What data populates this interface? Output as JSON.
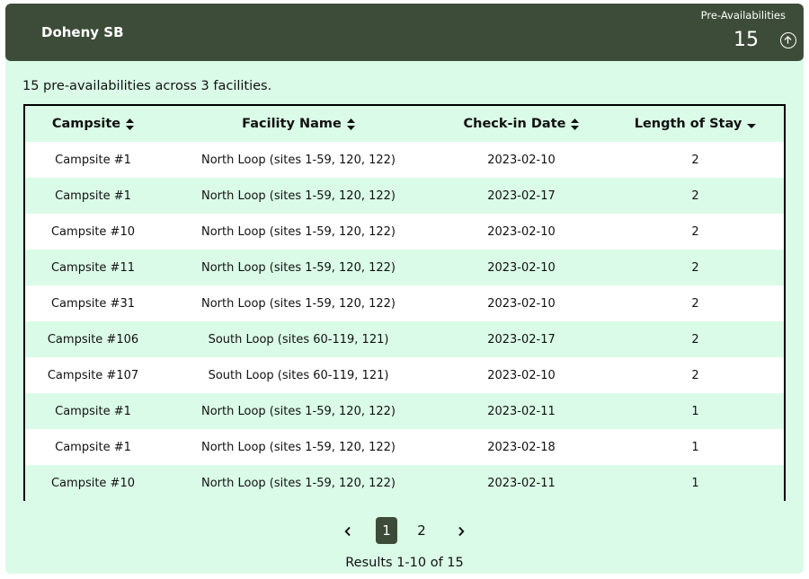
{
  "header": {
    "park_name": "Doheny SB",
    "stat_label": "Pre-Availabilities",
    "stat_value": "15"
  },
  "summary": "15 pre-availabilities across 3 facilities.",
  "table": {
    "columns": [
      "Campsite",
      "Facility Name",
      "Check-in Date",
      "Length of Stay"
    ],
    "rows": [
      [
        "Campsite #1",
        "North Loop (sites 1-59, 120, 122)",
        "2023-02-10",
        "2"
      ],
      [
        "Campsite #1",
        "North Loop (sites 1-59, 120, 122)",
        "2023-02-17",
        "2"
      ],
      [
        "Campsite #10",
        "North Loop (sites 1-59, 120, 122)",
        "2023-02-10",
        "2"
      ],
      [
        "Campsite #11",
        "North Loop (sites 1-59, 120, 122)",
        "2023-02-10",
        "2"
      ],
      [
        "Campsite #31",
        "North Loop (sites 1-59, 120, 122)",
        "2023-02-10",
        "2"
      ],
      [
        "Campsite #106",
        "South Loop (sites 60-119, 121)",
        "2023-02-17",
        "2"
      ],
      [
        "Campsite #107",
        "South Loop (sites 60-119, 121)",
        "2023-02-10",
        "2"
      ],
      [
        "Campsite #1",
        "North Loop (sites 1-59, 120, 122)",
        "2023-02-11",
        "1"
      ],
      [
        "Campsite #1",
        "North Loop (sites 1-59, 120, 122)",
        "2023-02-18",
        "1"
      ],
      [
        "Campsite #10",
        "North Loop (sites 1-59, 120, 122)",
        "2023-02-11",
        "1"
      ]
    ]
  },
  "pagination": {
    "pages": [
      "1",
      "2"
    ],
    "current": "1"
  },
  "results_text": "Results 1-10 of 15",
  "colors": {
    "header_bg": "#3d4c38",
    "panel_bg": "#dafbe7"
  }
}
